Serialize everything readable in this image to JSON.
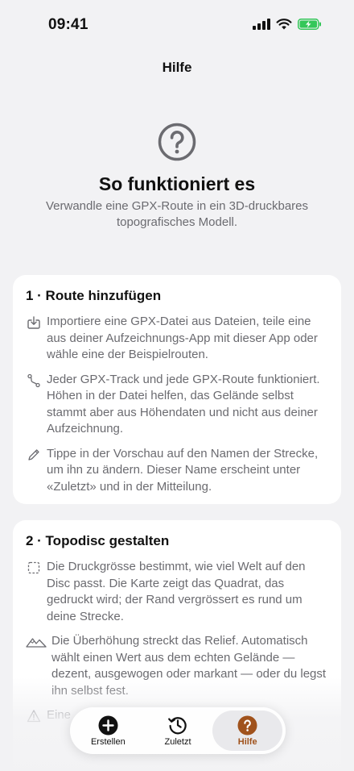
{
  "status_bar": {
    "time": "09:41"
  },
  "nav": {
    "title": "Hilfe"
  },
  "hero": {
    "icon": "question-circle-icon",
    "title": "So funktioniert es",
    "subtitle": "Verwandle eine GPX-Route in ein 3D-druckbares topografisches Modell."
  },
  "sections": [
    {
      "title": "1 · Route hinzufügen",
      "steps": [
        {
          "icon": "import-icon",
          "text": "Importiere eine GPX-Datei aus Dateien, teile eine aus deiner Aufzeichnungs-App mit dieser App oder wähle eine der Beispielrouten."
        },
        {
          "icon": "route-icon",
          "text": "Jeder GPX-Track und jede GPX-Route funktioniert. Höhen in der Datei helfen, das Gelände selbst stammt aber aus Höhendaten und nicht aus deiner Aufzeichnung."
        },
        {
          "icon": "pencil-icon",
          "text": "Tippe in der Vorschau auf den Namen der Strecke, um ihn zu ändern. Dieser Name erscheint unter «Zuletzt» und in der Mitteilung."
        }
      ]
    },
    {
      "title": "2 · Topodisc gestalten",
      "steps": [
        {
          "icon": "dashed-square-icon",
          "text": "Die Druckgrösse bestimmt, wie viel Welt auf den Disc passt. Die Karte zeigt das Quadrat, das gedruckt wird; der Rand vergrössert es rund um deine Strecke."
        },
        {
          "icon": "mountains-icon",
          "text": "Die Überhöhung streckt das Relief. Automatisch wählt einen Wert aus dem echten Gelände — dezent, ausgewogen oder markant — oder du legst ihn selbst fest."
        },
        {
          "icon": "warning-icon",
          "text": "Eine"
        }
      ]
    }
  ],
  "tab_bar": {
    "tabs": [
      {
        "label": "Erstellen",
        "icon": "plus-circle-icon"
      },
      {
        "label": "Zuletzt",
        "icon": "history-icon"
      },
      {
        "label": "Hilfe",
        "icon": "question-circle-icon"
      }
    ],
    "active_color": "#a0521c"
  }
}
